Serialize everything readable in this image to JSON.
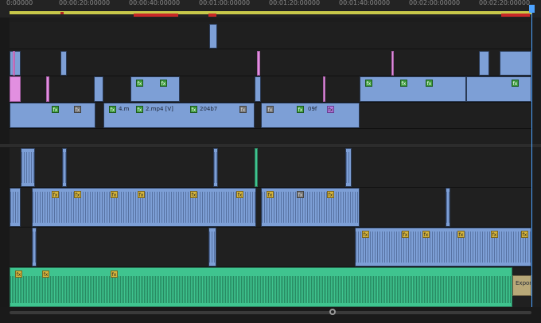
{
  "app": {
    "name": "sequence-timeline"
  },
  "ruler": {
    "ticks": [
      "0:00000",
      "00:00:20:00000",
      "00:00:40:00000",
      "00:01:00:00000",
      "00:01:20:00000",
      "00:01:40:00000",
      "00:02:00:00000",
      "00:02:20:00000"
    ]
  },
  "clips": {
    "label_4m": "4.m",
    "label_2mp4": "2.mp4 [V]",
    "label_204b7": "204b7",
    "label_09f": "09f",
    "label_export": "Export"
  },
  "icons": {
    "fx": "fx",
    "effect_green": "fx-green-icon",
    "effect_yellow": "fx-yellow-icon"
  },
  "colors": {
    "video_clip": "#7d9fd6",
    "audio_clip": "#7d9fd6",
    "music_clip": "#3fc48f",
    "marker_pink": "#e28fe0",
    "playhead": "#4da3ff"
  }
}
